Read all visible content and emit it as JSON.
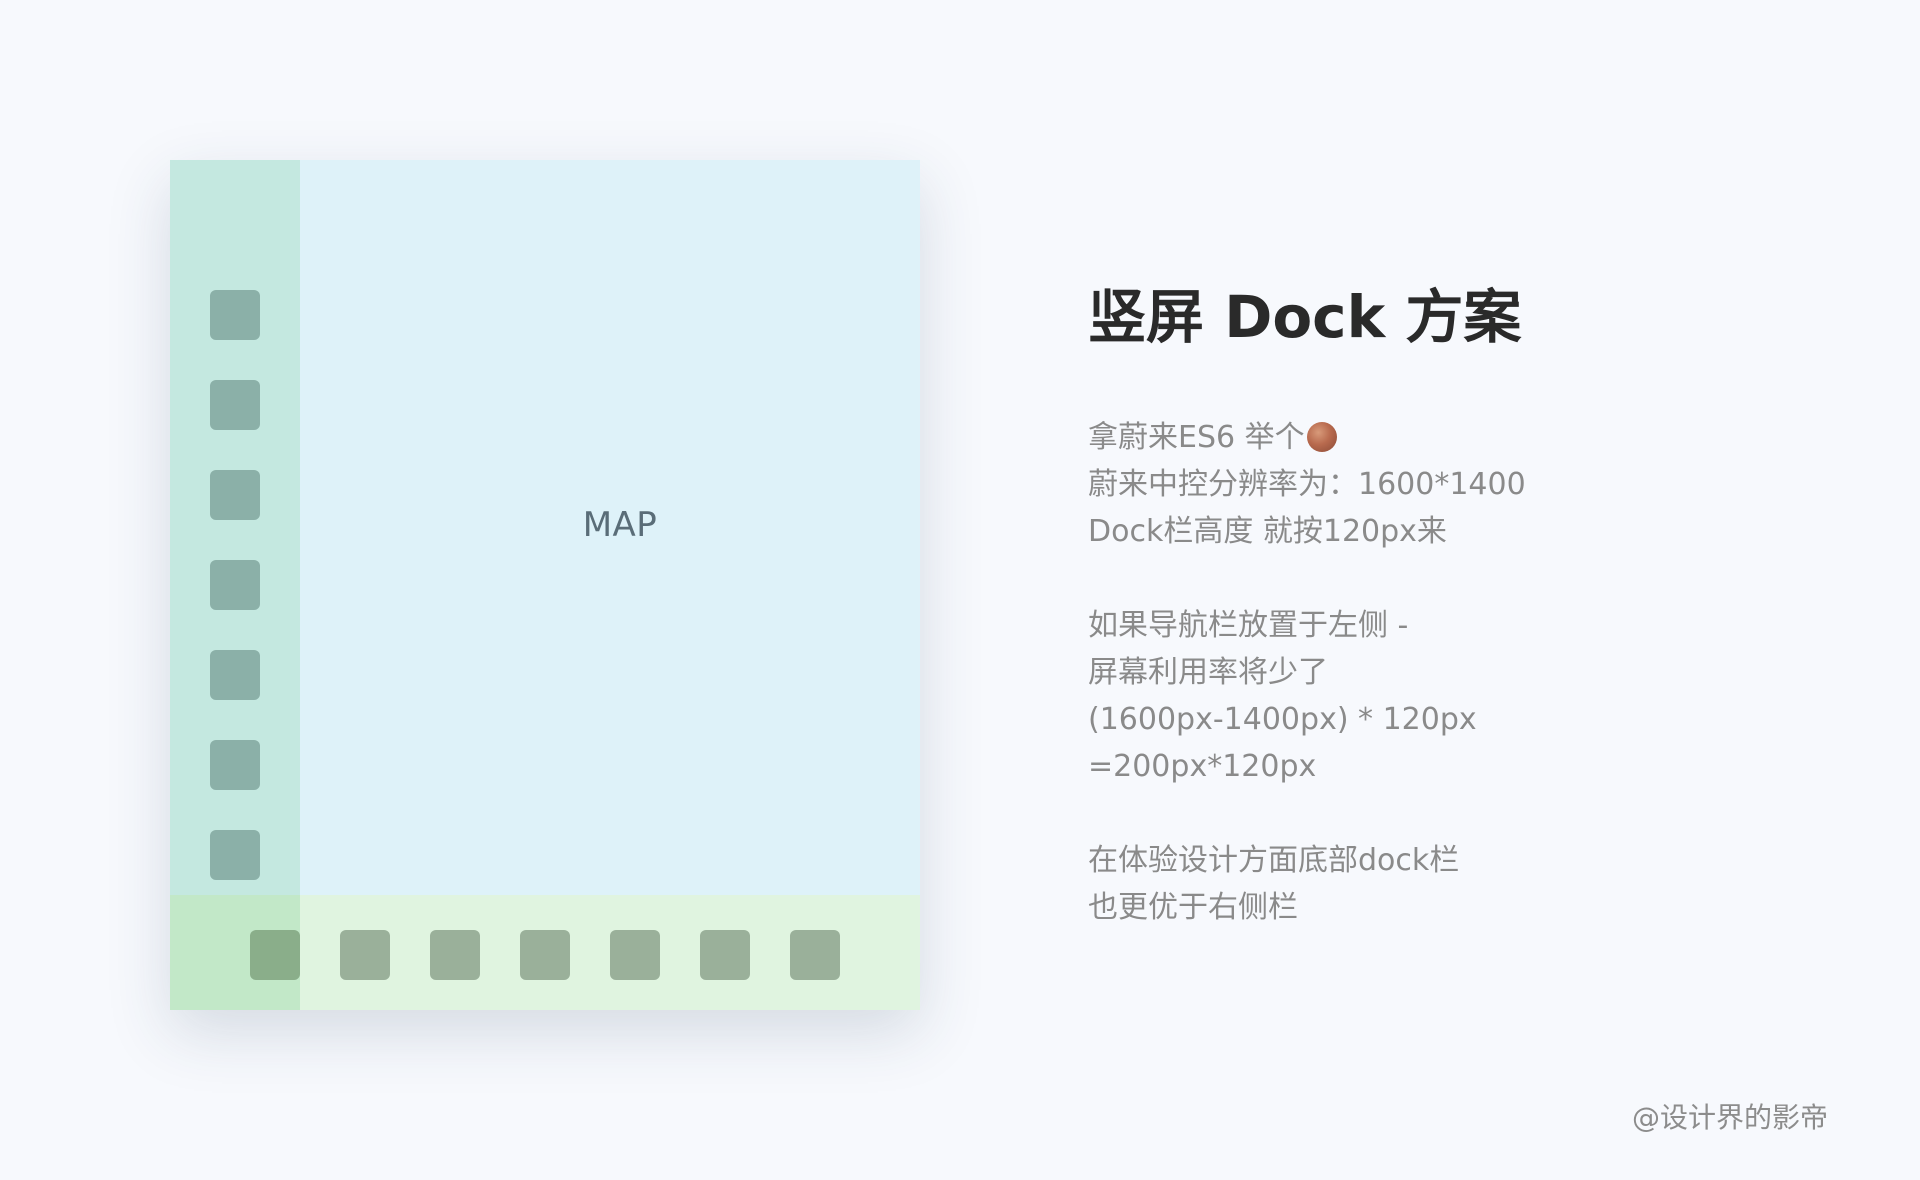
{
  "diagram": {
    "map_label": "MAP",
    "left_dock_icon_count": 7,
    "bottom_dock_icon_count": 7,
    "colors": {
      "page_background": "#f7f9fd",
      "map_area": "#def2f9",
      "left_dock": "#c4e8e0",
      "bottom_dock": "#e0f4e0",
      "overlap_zone": "#c2e8c8",
      "left_icon": "#8bb0a8",
      "bottom_icon": "#9ab09a"
    }
  },
  "title": "竖屏 Dock 方案",
  "description": {
    "p1": {
      "line1": "拿蔚来ES6 举个",
      "line1_icon": "ball-icon",
      "line2": "蔚来中控分辨率为：1600*1400",
      "line3": "Dock栏高度 就按120px来"
    },
    "p2": {
      "line1": "如果导航栏放置于左侧 -",
      "line2": "屏幕利用率将少了",
      "line3": "(1600px-1400px) * 120px",
      "line4": "=200px*120px"
    },
    "p3": {
      "line1": "在体验设计方面底部dock栏",
      "line2": "也更优于右侧栏"
    }
  },
  "credit": "@设计界的影帝"
}
